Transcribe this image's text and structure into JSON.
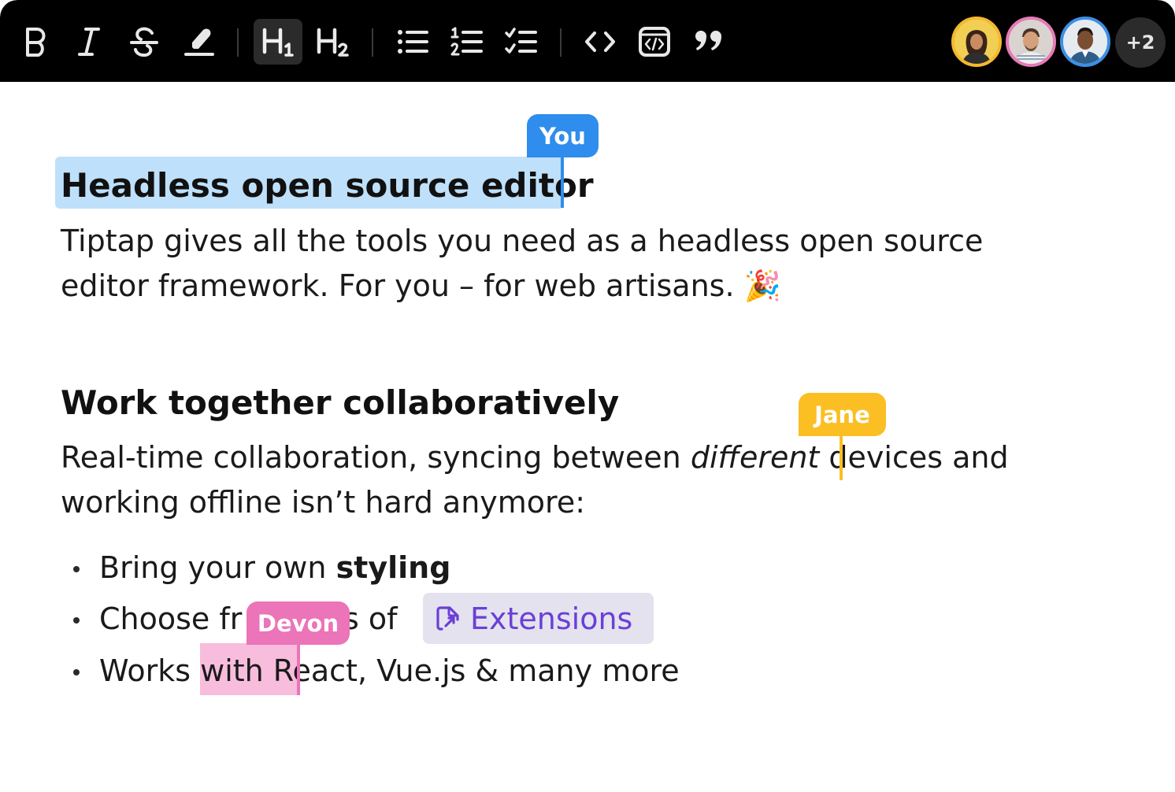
{
  "toolbar": {
    "buttons": [
      {
        "name": "bold",
        "icon": "bold-icon"
      },
      {
        "name": "italic",
        "icon": "italic-icon"
      },
      {
        "name": "strike",
        "icon": "strikethrough-icon"
      },
      {
        "name": "highlight",
        "icon": "highlighter-icon"
      },
      {
        "name": "heading-1",
        "icon": "heading-1-icon",
        "active": true
      },
      {
        "name": "heading-2",
        "icon": "heading-2-icon"
      },
      {
        "name": "bullet-list",
        "icon": "bullet-list-icon"
      },
      {
        "name": "ordered-list",
        "icon": "ordered-list-icon"
      },
      {
        "name": "task-list",
        "icon": "task-list-icon"
      },
      {
        "name": "code",
        "icon": "code-icon"
      },
      {
        "name": "code-block",
        "icon": "code-block-icon"
      },
      {
        "name": "blockquote",
        "icon": "quote-icon"
      }
    ],
    "collaborators": [
      {
        "ring": "#f5b82e"
      },
      {
        "ring": "#e67ab6"
      },
      {
        "ring": "#3b8fe6"
      }
    ],
    "more_count": "+2"
  },
  "doc": {
    "h1": "Headless open source editor",
    "p1_line1": "Tiptap gives all the tools you need as a headless open source",
    "p1_line2": "editor framework. For you – for web artisans.",
    "p1_emoji": "🎉",
    "h2": "Work together collaboratively",
    "p2_pre": "Real-time collaboration, syncing between ",
    "p2_italic": "different",
    "p2_post": " devices and",
    "p2_line2": "working offline isn’t hard anymore:",
    "list": {
      "item1_pre": "Bring your own ",
      "item1_bold": "styling",
      "item2_a": "Choose fr",
      "item2_b": "s of",
      "item2_link": "Extensions",
      "item3_a": "Works ",
      "item3_b": "with R",
      "item3_c": "eact, Vue.js & many more"
    }
  },
  "cursors": {
    "you": {
      "label": "You",
      "color": "#2f8ded"
    },
    "jane": {
      "label": "Jane",
      "color": "#fbbf24"
    },
    "devon": {
      "label": "Devon",
      "color": "#ec74b8"
    }
  }
}
